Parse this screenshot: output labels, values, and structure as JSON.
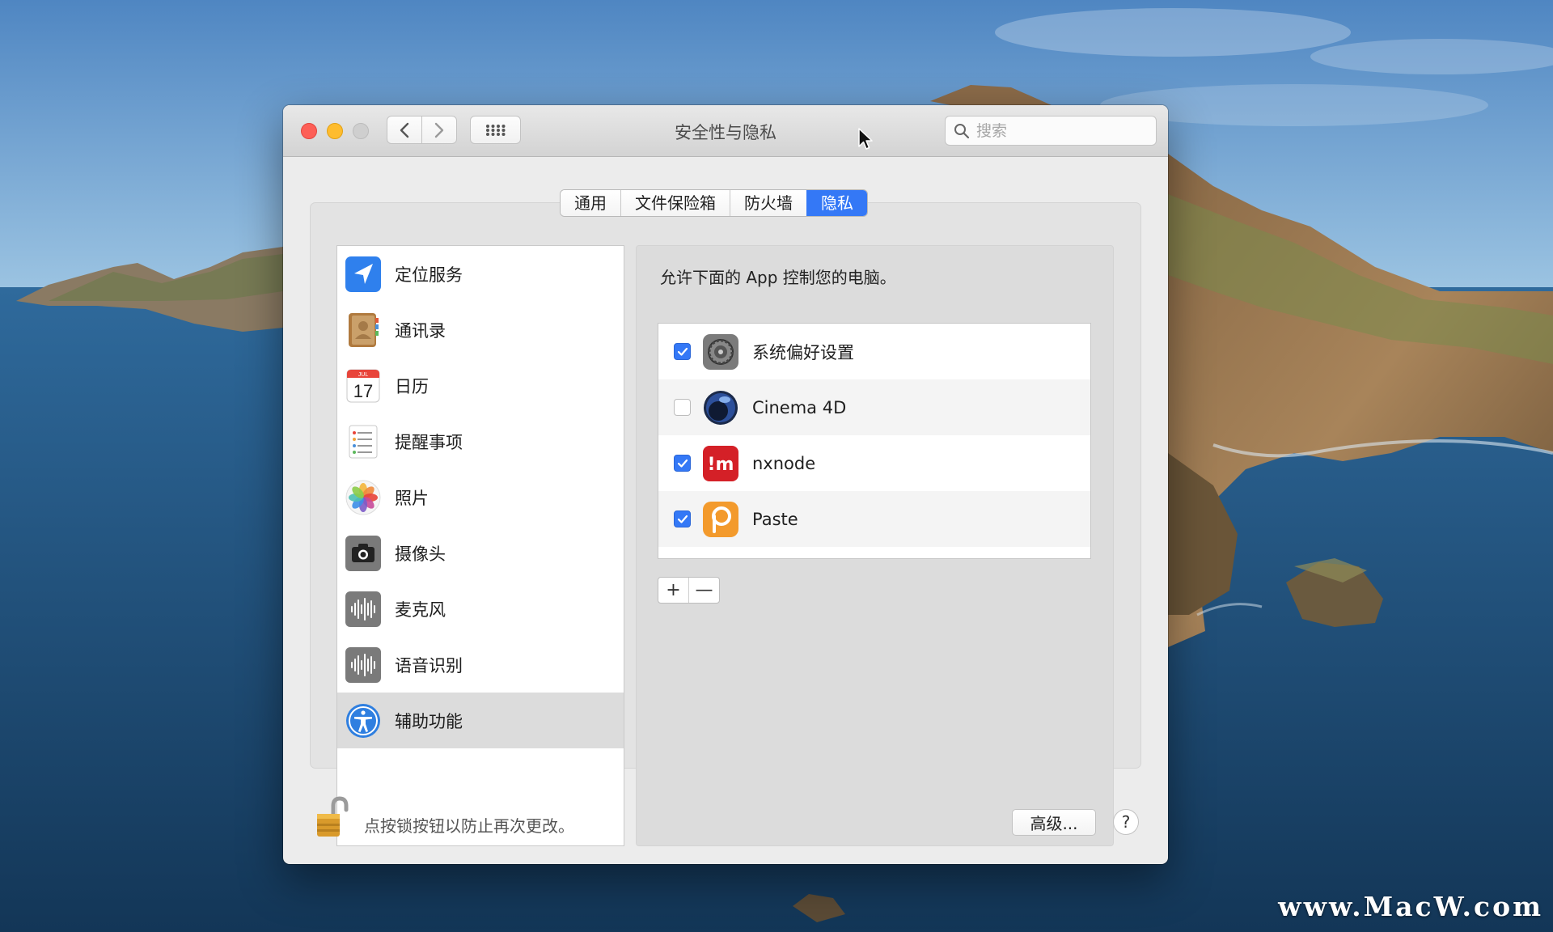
{
  "window": {
    "title": "安全性与隐私"
  },
  "toolbar": {
    "back_icon": "chevron-left-icon",
    "forward_icon": "chevron-right-icon",
    "grid_icon": "grid-icon",
    "search_placeholder": "搜索"
  },
  "tabs": [
    {
      "label": "通用",
      "active": false
    },
    {
      "label": "文件保险箱",
      "active": false
    },
    {
      "label": "防火墙",
      "active": false
    },
    {
      "label": "隐私",
      "active": true
    }
  ],
  "categories": [
    {
      "label": "定位服务",
      "icon": "location-icon"
    },
    {
      "label": "通讯录",
      "icon": "contacts-icon"
    },
    {
      "label": "日历",
      "icon": "calendar-icon",
      "calendar_month": "JUL",
      "calendar_day": "17"
    },
    {
      "label": "提醒事项",
      "icon": "reminders-icon"
    },
    {
      "label": "照片",
      "icon": "photos-icon"
    },
    {
      "label": "摄像头",
      "icon": "camera-icon"
    },
    {
      "label": "麦克风",
      "icon": "microphone-icon"
    },
    {
      "label": "语音识别",
      "icon": "speech-recognition-icon"
    },
    {
      "label": "辅助功能",
      "icon": "accessibility-icon",
      "selected": true
    }
  ],
  "main": {
    "description": "允许下面的 App 控制您的电脑。",
    "apps": [
      {
        "name": "系统偏好设置",
        "checked": true,
        "icon": "system-preferences-icon"
      },
      {
        "name": "Cinema 4D",
        "checked": false,
        "icon": "cinema4d-icon"
      },
      {
        "name": "nxnode",
        "checked": true,
        "icon": "nxnode-icon",
        "icon_text": "!m"
      },
      {
        "name": "Paste",
        "checked": true,
        "icon": "paste-icon"
      }
    ],
    "add_symbol": "+",
    "remove_symbol": "—"
  },
  "footer": {
    "lock_text": "点按锁按钮以防止再次更改。",
    "advanced_label": "高级...",
    "help_label": "?"
  },
  "desktop": {
    "watermark": "www.MacW.com"
  },
  "colors": {
    "accent": "#3478f6",
    "close": "#fd5f57",
    "minimize": "#febc2e",
    "zoom": "#cfcfcf"
  }
}
